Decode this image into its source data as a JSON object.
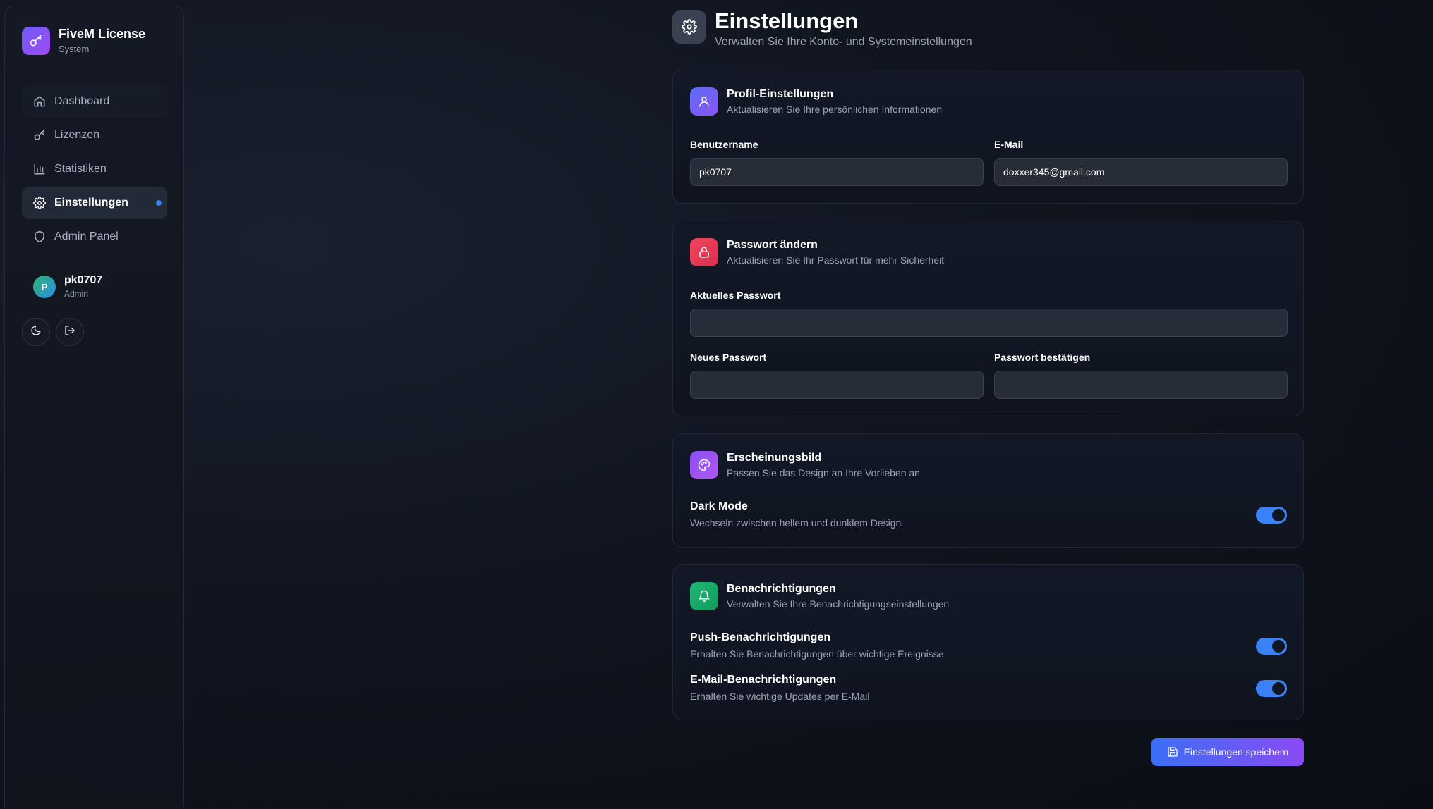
{
  "brand": {
    "title": "FiveM License",
    "subtitle": "System"
  },
  "nav": {
    "items": [
      {
        "label": "Dashboard",
        "icon": "home-icon"
      },
      {
        "label": "Lizenzen",
        "icon": "key-icon"
      },
      {
        "label": "Statistiken",
        "icon": "bar-chart-icon"
      },
      {
        "label": "Einstellungen",
        "icon": "gear-icon",
        "active": true
      },
      {
        "label": "Admin Panel",
        "icon": "shield-icon"
      }
    ]
  },
  "user": {
    "initial": "P",
    "name": "pk0707",
    "role": "Admin"
  },
  "header": {
    "title": "Einstellungen",
    "subtitle": "Verwalten Sie Ihre Konto- und Systemeinstellungen"
  },
  "profile": {
    "title": "Profil-Einstellungen",
    "subtitle": "Aktualisieren Sie Ihre persönlichen Informationen",
    "username_label": "Benutzername",
    "username_value": "pk0707",
    "email_label": "E-Mail",
    "email_value": "doxxer345@gmail.com"
  },
  "password": {
    "title": "Passwort ändern",
    "subtitle": "Aktualisieren Sie Ihr Passwort für mehr Sicherheit",
    "current_label": "Aktuelles Passwort",
    "new_label": "Neues Passwort",
    "confirm_label": "Passwort bestätigen"
  },
  "appearance": {
    "title": "Erscheinungsbild",
    "subtitle": "Passen Sie das Design an Ihre Vorlieben an",
    "dark_mode_title": "Dark Mode",
    "dark_mode_sub": "Wechseln zwischen hellem und dunklem Design",
    "dark_mode_on": true
  },
  "notifications": {
    "title": "Benachrichtigungen",
    "subtitle": "Verwalten Sie Ihre Benachrichtigungseinstellungen",
    "push_title": "Push-Benachrichtigungen",
    "push_sub": "Erhalten Sie Benachrichtigungen über wichtige Ereignisse",
    "push_on": true,
    "email_title": "E-Mail-Benachrichtigungen",
    "email_sub": "Erhalten Sie wichtige Updates per E-Mail",
    "email_on": true
  },
  "save_label": "Einstellungen speichern",
  "colors": {
    "accent": "#3b82f6",
    "profile_icon": "#6d5cf6",
    "password_icon": "#e8365a",
    "appearance_icon": "#9b4ef2",
    "notifications_icon": "#1fae6a"
  }
}
